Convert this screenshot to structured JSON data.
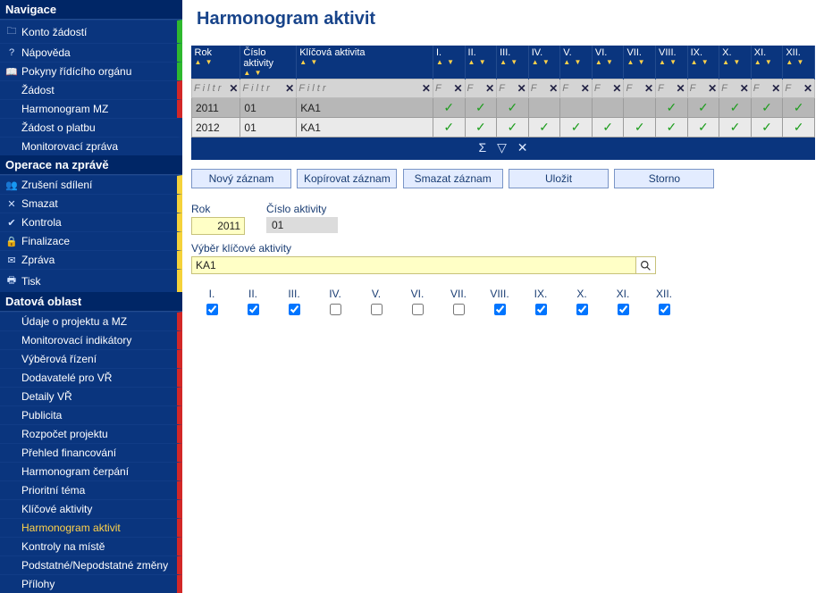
{
  "sidebar": {
    "sections": [
      {
        "title": "Navigace",
        "items": [
          {
            "icon": "🗀",
            "label": "Konto žádostí",
            "stripe": "green",
            "active": false
          },
          {
            "icon": "?",
            "label": "Nápověda",
            "stripe": "green",
            "active": false
          },
          {
            "icon": "📖",
            "label": "Pokyny řídícího orgánu",
            "stripe": "green",
            "active": false
          },
          {
            "icon": "",
            "label": "Žádost",
            "stripe": "red",
            "active": false
          },
          {
            "icon": "",
            "label": "Harmonogram MZ",
            "stripe": "red",
            "active": false
          },
          {
            "icon": "",
            "label": "Žádost o platbu",
            "stripe": "none",
            "active": false
          },
          {
            "icon": "",
            "label": "Monitorovací zpráva",
            "stripe": "none",
            "active": false
          }
        ]
      },
      {
        "title": "Operace na zprávě",
        "items": [
          {
            "icon": "👥",
            "label": "Zrušení sdílení",
            "stripe": "yellow",
            "active": false
          },
          {
            "icon": "✕",
            "label": "Smazat",
            "stripe": "yellow",
            "active": false
          },
          {
            "icon": "✔",
            "label": "Kontrola",
            "stripe": "yellow",
            "active": false
          },
          {
            "icon": "🔒",
            "label": "Finalizace",
            "stripe": "yellow",
            "active": false
          },
          {
            "icon": "✉",
            "label": "Zpráva",
            "stripe": "yellow",
            "active": false
          },
          {
            "icon": "🖶",
            "label": "Tisk",
            "stripe": "yellow",
            "active": false
          }
        ]
      },
      {
        "title": "Datová oblast",
        "items": [
          {
            "icon": "",
            "label": "Údaje o projektu a MZ",
            "stripe": "red",
            "active": false
          },
          {
            "icon": "",
            "label": "Monitorovací indikátory",
            "stripe": "red",
            "active": false
          },
          {
            "icon": "",
            "label": "Výběrová řízení",
            "stripe": "red",
            "active": false
          },
          {
            "icon": "",
            "label": "Dodavatelé pro VŘ",
            "stripe": "red",
            "active": false
          },
          {
            "icon": "",
            "label": "Detaily VŘ",
            "stripe": "red",
            "active": false
          },
          {
            "icon": "",
            "label": "Publicita",
            "stripe": "red",
            "active": false
          },
          {
            "icon": "",
            "label": "Rozpočet projektu",
            "stripe": "red",
            "active": false
          },
          {
            "icon": "",
            "label": "Přehled financování",
            "stripe": "red",
            "active": false
          },
          {
            "icon": "",
            "label": "Harmonogram čerpání",
            "stripe": "red",
            "active": false
          },
          {
            "icon": "",
            "label": "Prioritní téma",
            "stripe": "red",
            "active": false
          },
          {
            "icon": "",
            "label": "Klíčové aktivity",
            "stripe": "red",
            "active": false
          },
          {
            "icon": "",
            "label": "Harmonogram aktivit",
            "stripe": "red",
            "active": true
          },
          {
            "icon": "",
            "label": "Kontroly na místě",
            "stripe": "red",
            "active": false
          },
          {
            "icon": "",
            "label": "Podstatné/Nepodstatné změny",
            "stripe": "red",
            "active": false
          },
          {
            "icon": "",
            "label": "Přílohy",
            "stripe": "red",
            "active": false
          }
        ]
      }
    ]
  },
  "page": {
    "title": "Harmonogram aktivit"
  },
  "grid": {
    "headers": {
      "rok": "Rok",
      "cislo": "Číslo aktivity",
      "klicova": "Klíčová aktivita",
      "months": [
        "I.",
        "II.",
        "III.",
        "IV.",
        "V.",
        "VI.",
        "VII.",
        "VIII.",
        "IX.",
        "X.",
        "XI.",
        "XII."
      ]
    },
    "filter_placeholder": "F i l t r",
    "filter_placeholder_short": "F",
    "rows": [
      {
        "rok": "2011",
        "cislo": "01",
        "klic": "KA1",
        "m": [
          true,
          true,
          true,
          false,
          false,
          false,
          false,
          true,
          true,
          true,
          true,
          true
        ]
      },
      {
        "rok": "2012",
        "cislo": "01",
        "klic": "KA1",
        "m": [
          true,
          true,
          true,
          true,
          true,
          true,
          true,
          true,
          true,
          true,
          true,
          true
        ]
      }
    ],
    "footer_icons": {
      "sum": "Σ",
      "filter": "▽",
      "clear": "✕"
    }
  },
  "buttons": {
    "novy": "Nový záznam",
    "kopir": "Kopírovat záznam",
    "smazat": "Smazat záznam",
    "ulozit": "Uložit",
    "storno": "Storno"
  },
  "form": {
    "rok_label": "Rok",
    "rok_value": "2011",
    "cislo_label": "Číslo aktivity",
    "cislo_value": "01",
    "vyber_label": "Výběr klíčové aktivity",
    "vyber_value": "KA1",
    "months_labels": [
      "I.",
      "II.",
      "III.",
      "IV.",
      "V.",
      "VI.",
      "VII.",
      "VIII.",
      "IX.",
      "X.",
      "XI.",
      "XII."
    ],
    "months_checked": [
      true,
      true,
      true,
      false,
      false,
      false,
      false,
      true,
      true,
      true,
      true,
      true
    ]
  }
}
